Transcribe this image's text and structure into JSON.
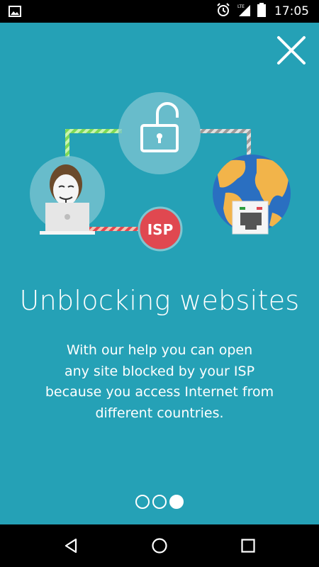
{
  "status_bar": {
    "time": "17:05",
    "network": "LTE",
    "icons": [
      "image-icon",
      "alarm-icon",
      "lte-signal-icon",
      "battery-icon"
    ]
  },
  "onboarding": {
    "title": "Unblocking websites",
    "description_lines": [
      "With our help you can open",
      "any site blocked by your ISP",
      "because you access Internet from",
      "different countries."
    ],
    "isp_label": "ISP",
    "pages": 3,
    "current_page": 3
  },
  "colors": {
    "background": "#25a1b6",
    "isp_badge": "#e04850",
    "globe_ocean": "#2a6fc1",
    "globe_land": "#f2b44a",
    "green_wire": "#7ed957",
    "red_wire": "#e04850",
    "gray_wire": "#b0b0b0"
  },
  "nav_bar": {
    "icons": [
      "back-icon",
      "home-icon",
      "recents-icon"
    ]
  }
}
